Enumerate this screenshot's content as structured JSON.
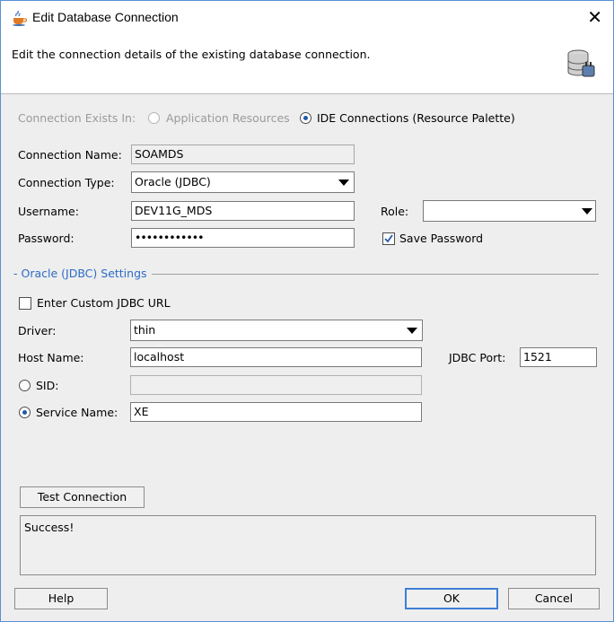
{
  "window": {
    "title": "Edit Database Connection",
    "close_icon": "close-icon"
  },
  "header": {
    "description": "Edit the connection details of the existing database connection.",
    "icon": "database-connection-icon"
  },
  "connection_exists_in": {
    "label": "Connection Exists In:",
    "options": [
      {
        "label": "Application Resources",
        "selected": false,
        "enabled": false
      },
      {
        "label": "IDE Connections (Resource Palette)",
        "selected": true,
        "enabled": true
      }
    ]
  },
  "connection": {
    "name_label": "Connection Name:",
    "name_value": "SOAMDS",
    "type_label": "Connection Type:",
    "type_value": "Oracle (JDBC)",
    "username_label": "Username:",
    "username_value": "DEV11G_MDS",
    "password_label": "Password:",
    "password_value": "••••••••••••",
    "role_label": "Role:",
    "role_value": "",
    "save_password_label": "Save Password",
    "save_password_checked": true
  },
  "settings": {
    "section_label": "- Oracle (JDBC) Settings",
    "custom_url_label": "Enter Custom JDBC URL",
    "custom_url_checked": false,
    "driver_label": "Driver:",
    "driver_value": "thin",
    "host_label": "Host Name:",
    "host_value": "localhost",
    "port_label": "JDBC Port:",
    "port_value": "1521",
    "sid_label": "SID:",
    "sid_value": "",
    "sid_selected": false,
    "service_label": "Service Name:",
    "service_value": "XE",
    "service_selected": true
  },
  "test": {
    "button_label": "Test Connection",
    "result": "Success!"
  },
  "footer": {
    "help_label": "Help",
    "ok_label": "OK",
    "cancel_label": "Cancel"
  }
}
